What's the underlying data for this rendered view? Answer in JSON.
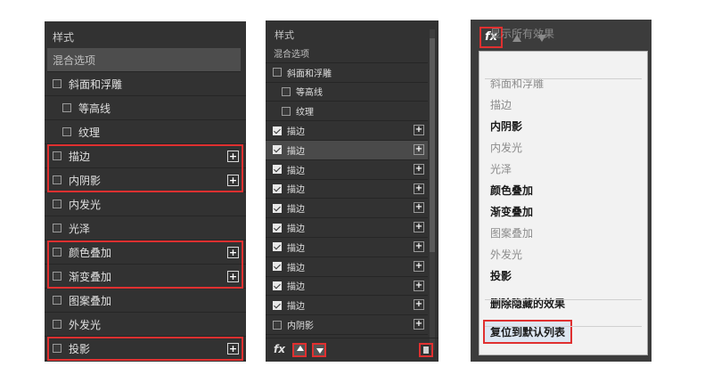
{
  "panel1": {
    "header": "样式",
    "items": [
      {
        "label": "混合选项",
        "type": "header",
        "selected": true
      },
      {
        "label": "斜面和浮雕",
        "checked": false,
        "indent": false
      },
      {
        "label": "等高线",
        "checked": false,
        "indent": true
      },
      {
        "label": "纹理",
        "checked": false,
        "indent": true
      },
      {
        "label": "描边",
        "checked": false,
        "plus": true
      },
      {
        "label": "内阴影",
        "checked": false,
        "plus": true
      },
      {
        "label": "内发光",
        "checked": false
      },
      {
        "label": "光泽",
        "checked": false
      },
      {
        "label": "颜色叠加",
        "checked": false,
        "plus": true
      },
      {
        "label": "渐变叠加",
        "checked": false,
        "plus": true
      },
      {
        "label": "图案叠加",
        "checked": false
      },
      {
        "label": "外发光",
        "checked": false
      },
      {
        "label": "投影",
        "checked": false,
        "plus": true
      }
    ]
  },
  "panel2": {
    "header": "样式",
    "items": [
      {
        "label": "混合选项",
        "type": "header"
      },
      {
        "label": "斜面和浮雕",
        "checked": false
      },
      {
        "label": "等高线",
        "checked": false,
        "indent": true
      },
      {
        "label": "纹理",
        "checked": false,
        "indent": true
      },
      {
        "label": "描边",
        "checked": true,
        "plus": true
      },
      {
        "label": "描边",
        "checked": true,
        "plus": true,
        "selected": true
      },
      {
        "label": "描边",
        "checked": true,
        "plus": true
      },
      {
        "label": "描边",
        "checked": true,
        "plus": true
      },
      {
        "label": "描边",
        "checked": true,
        "plus": true
      },
      {
        "label": "描边",
        "checked": true,
        "plus": true
      },
      {
        "label": "描边",
        "checked": true,
        "plus": true
      },
      {
        "label": "描边",
        "checked": true,
        "plus": true
      },
      {
        "label": "描边",
        "checked": true,
        "plus": true
      },
      {
        "label": "描边",
        "checked": true,
        "plus": true
      },
      {
        "label": "内阴影",
        "checked": false,
        "plus": true
      }
    ],
    "fx_label": "fx"
  },
  "panel3": {
    "fx_label": "fx",
    "menu": [
      {
        "label": "显示所有效果",
        "style": "gray"
      },
      {
        "label": "斜面和浮雕",
        "style": "gray"
      },
      {
        "label": "描边",
        "style": "gray"
      },
      {
        "label": "内阴影",
        "style": "bold"
      },
      {
        "label": "内发光",
        "style": "gray"
      },
      {
        "label": "光泽",
        "style": "gray"
      },
      {
        "label": "颜色叠加",
        "style": "bold"
      },
      {
        "label": "渐变叠加",
        "style": "bold"
      },
      {
        "label": "图案叠加",
        "style": "gray"
      },
      {
        "label": "外发光",
        "style": "gray"
      },
      {
        "label": "投影",
        "style": "bold"
      },
      {
        "label": "删除隐藏的效果",
        "style": "bold"
      },
      {
        "label": "复位到默认列表",
        "style": "bold"
      }
    ]
  },
  "icons": {
    "plus": "plus-icon",
    "up": "arrow-up-icon",
    "down": "arrow-down-icon",
    "trash": "trash-icon",
    "fx": "fx-icon"
  },
  "colors": {
    "panel": "#323232",
    "highlight": "#e03030",
    "selected": "#4a4a4a"
  }
}
